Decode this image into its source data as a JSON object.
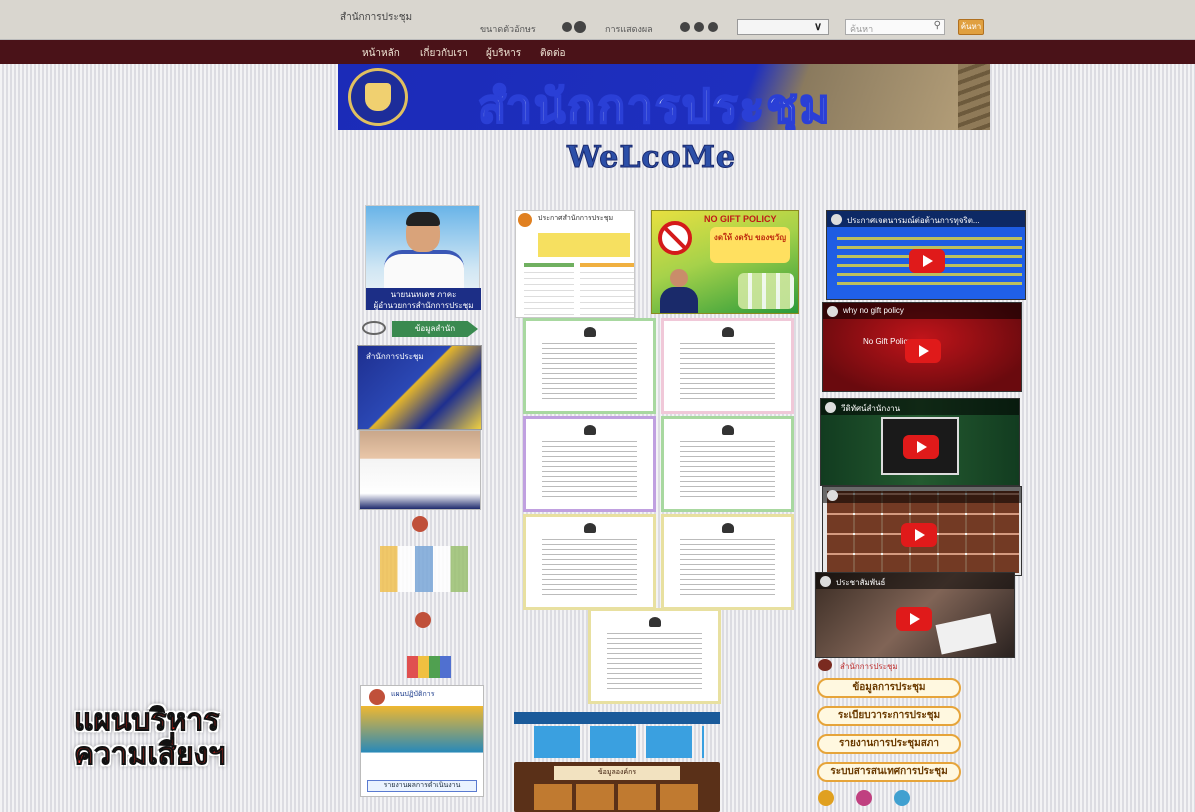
{
  "topbar": {
    "site_name": "สำนักการประชุม",
    "font_size_label": "ขนาดตัวอักษร",
    "display_label": "การแสดงผล",
    "select_value": "",
    "search_placeholder": "ค้นหา",
    "go_label": "ค้นหา"
  },
  "nav": {
    "items": [
      "หน้าหลัก",
      "เกี่ยวกับเรา",
      "ผู้บริหาร",
      "ติดต่อ"
    ]
  },
  "banner": {
    "title": "สำนักการประชุม"
  },
  "welcome": "WeLcoMe",
  "portrait": {
    "caption_line1": "นายนนทเดช ภาคะ",
    "caption_line2": "ผู้อำนวยการสำนักการประชุม"
  },
  "arrow_label": "ข้อมูลสำนัก",
  "poster1_label": "สำนักการประชุม",
  "poster3": {
    "head": "แผนปฏิบัติการ",
    "foot": "รายงานผลการดำเนินงาน"
  },
  "announce": {
    "headline": "ประกาศสำนักการประชุม"
  },
  "nogift": {
    "title": "NO GIFT POLICY",
    "message": "งดให้ งดรับ ของขวัญ"
  },
  "infographic": {
    "cabinet_label": "ข้อมูลองค์กร"
  },
  "videos": [
    {
      "header": "ประกาศเจตนารมณ์ต่อต้านการทุจริต..."
    },
    {
      "header": "why no gift policy",
      "text": "No Gift Policy"
    },
    {
      "header": "วีดิทัศน์สำนักงาน"
    },
    {
      "header": ""
    },
    {
      "header": "ประชาสัมพันธ์"
    }
  ],
  "fb_header": "สำนักการประชุม",
  "link_chips": [
    "ข้อมูลการประชุม",
    "ระเบียบวาระการประชุม",
    "รายงานการประชุมสภา",
    "ระบบสารสนเทศการประชุม"
  ],
  "overlay": {
    "line1": "แผนบริหาร",
    "line2": "ความเสี่ยงฯ"
  },
  "colors": {
    "nav_bg": "#4a1218",
    "banner_blue": "#1e2fbf",
    "accent_orange": "#e6a43a",
    "video_red": "#e01a1a"
  }
}
